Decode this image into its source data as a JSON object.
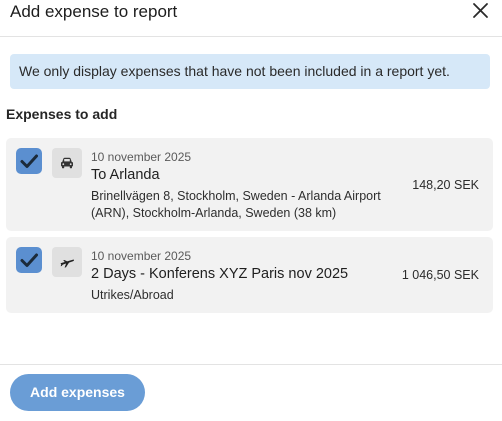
{
  "dialog": {
    "title": "Add expense to report",
    "close_icon": "close-icon"
  },
  "notice": {
    "text": "We only display expenses that have not been included in a report yet."
  },
  "section": {
    "title": "Expenses to add"
  },
  "expenses": [
    {
      "checked": true,
      "icon": "car-icon",
      "date": "10 november 2025",
      "title": "To Arlanda",
      "description": "Brinellvägen 8, Stockholm, Sweden - Arlanda Airport (ARN), Stockholm-Arlanda, Sweden (38 km)",
      "amount": "148,20 SEK"
    },
    {
      "checked": true,
      "icon": "airplane-icon",
      "date": "10 november 2025",
      "title": "2 Days - Konferens XYZ Paris nov 2025",
      "description": "Utrikes/Abroad",
      "amount": "1 046,50 SEK"
    }
  ],
  "footer": {
    "add_label": "Add expenses"
  },
  "colors": {
    "checkbox": "#5b8fd0",
    "notice_bg": "#d6e8f8",
    "card_bg": "#f2f2f2",
    "primary_button": "#6a9dd6"
  }
}
